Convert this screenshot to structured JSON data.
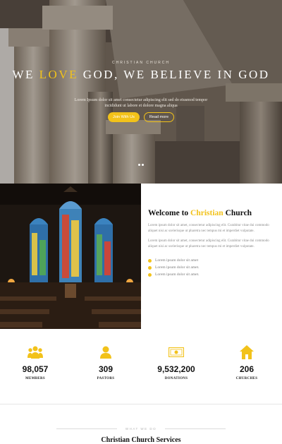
{
  "hero": {
    "eyebrow": "CHRISTIAN CHURCH",
    "title_part1": "WE ",
    "title_accent": "LOVE",
    "title_part2": " GOD, WE BELIEVE IN GOD",
    "subtitle": "Lorem Ipsum dolor sit amet consectetur adipiscing elit sed do eiusmod tempor incididunt ut labore et dolore magna aliqua",
    "primary_button": "Join With Us",
    "secondary_button": "Read more",
    "accent_color": "#f2c21a"
  },
  "welcome": {
    "title_part1": "Welcome to ",
    "title_accent": "Christian",
    "title_part2": " Church",
    "paragraph1": "Lorem ipsum dolor sit amet, consectetur adipiscing elit. Curabitur vitae dui commodo aliquet nisi ac scelerisque ut pharetra nec tempus mi et imperdiet vulputate.",
    "paragraph2": "Lorem ipsum dolor sit amet, consectetur adipiscing elit. Curabitur vitae dui commodo aliquet nisi ac scelerisque ut pharetra nec tempus mi et imperdiet vulputate.",
    "checklist": [
      "Lorem ipsum dolor sit amet",
      "Lorem ipsum dolor sit amet.",
      "Lorem ipsum dolor sit amet."
    ]
  },
  "stats": [
    {
      "icon": "members-icon",
      "value": "98,057",
      "label": "MEMBERS"
    },
    {
      "icon": "pastor-icon",
      "value": "309",
      "label": "PASTORS"
    },
    {
      "icon": "donation-icon",
      "value": "9,532,200",
      "label": "DONATIONS"
    },
    {
      "icon": "church-icon",
      "value": "206",
      "label": "CHURCHES"
    }
  ],
  "services": {
    "eyebrow": "WHAT WE DO",
    "title": "Christian Church Services"
  }
}
